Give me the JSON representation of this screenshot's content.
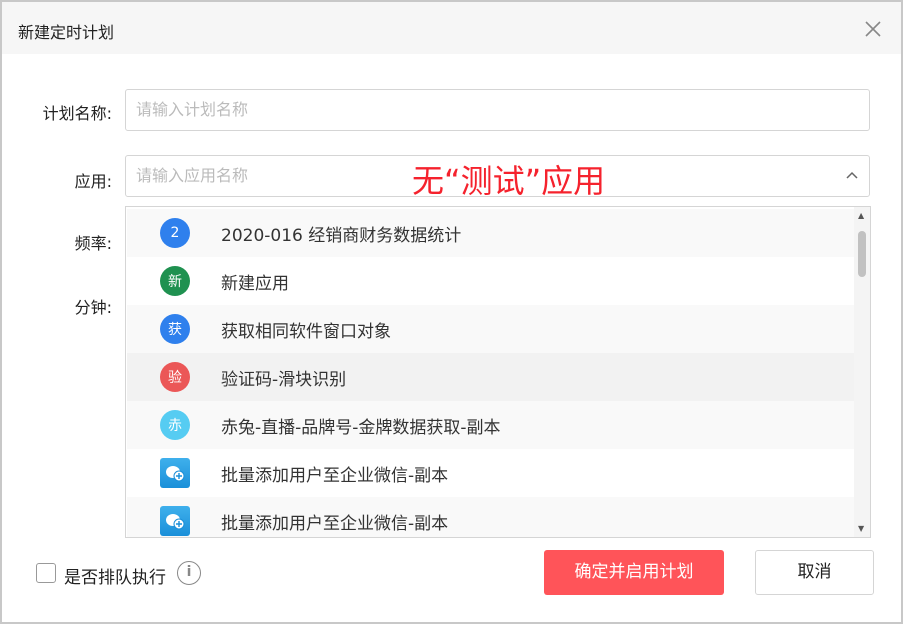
{
  "dialog": {
    "title": "新建定时计划"
  },
  "form": {
    "plan_name_label": "计划名称:",
    "plan_name_placeholder": "请输入计划名称",
    "app_label": "应用:",
    "app_placeholder": "请输入应用名称",
    "frequency_label": "频率:",
    "minute_label": "分钟:"
  },
  "annotation": "无“测试”应用",
  "dropdown": {
    "items": [
      {
        "badge": "2",
        "label": "2020-016 经销商财务数据统计",
        "color": "#2f80ed",
        "type": "circle"
      },
      {
        "badge": "新",
        "label": "新建应用",
        "color": "#1f9150",
        "type": "circle"
      },
      {
        "badge": "获",
        "label": "获取相同软件窗口对象",
        "color": "#2f80ed",
        "type": "circle"
      },
      {
        "badge": "验",
        "label": "验证码-滑块识别",
        "color": "#eb5757",
        "type": "circle"
      },
      {
        "badge": "赤",
        "label": "赤兔-直播-品牌号-金牌数据获取-副本",
        "color": "#56ccf2",
        "type": "circle"
      },
      {
        "badge": "",
        "label": "批量添加用户至企业微信-副本",
        "color": "#1a9be6",
        "type": "wechat-icon"
      },
      {
        "badge": "",
        "label": "批量添加用户至企业微信-副本",
        "color": "#1a9be6",
        "type": "wechat-icon"
      }
    ]
  },
  "footer": {
    "queue_label": "是否排队执行",
    "info_icon": "i",
    "confirm_label": "确定并启用计划",
    "cancel_label": "取消"
  }
}
